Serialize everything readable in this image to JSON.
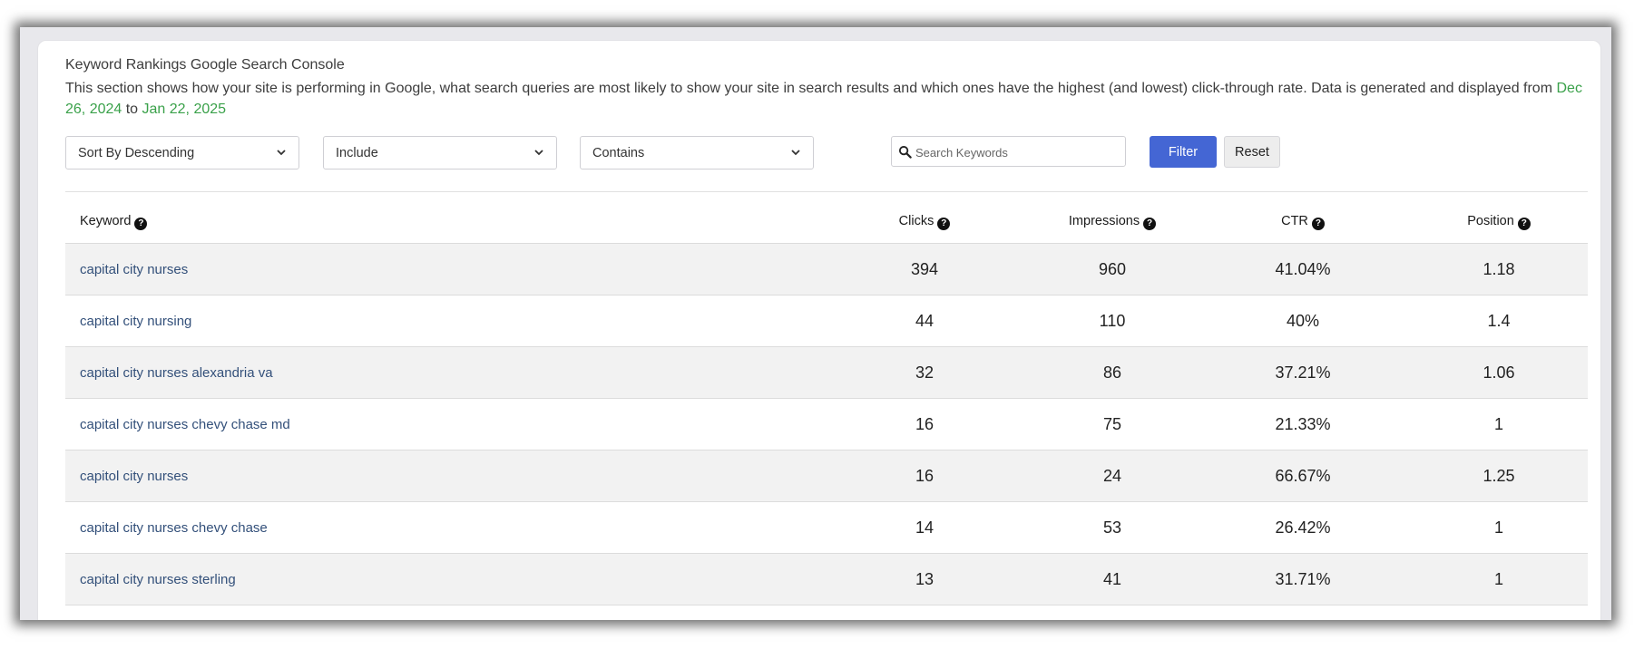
{
  "section": {
    "title": "Keyword Rankings Google Search Console",
    "description": "This section shows how your site is performing in Google, what search queries are most likely to show your site in search results and which ones have the highest (and lowest) click-through rate. Data is generated and displayed from ",
    "date_from": "Dec 26, 2024",
    "date_joiner": " to ",
    "date_to": "Jan 22, 2025",
    "accent_color": "#3aa14a"
  },
  "filters": {
    "sort_value": "Sort By Descending",
    "include_value": "Include",
    "match_value": "Contains",
    "search_placeholder": "Search Keywords",
    "filter_label": "Filter",
    "reset_label": "Reset",
    "filter_color": "#4466d4"
  },
  "table": {
    "headers": {
      "keyword": "Keyword",
      "clicks": "Clicks",
      "impressions": "Impressions",
      "ctr": "CTR",
      "position": "Position"
    },
    "rows": [
      {
        "keyword": "capital city nurses",
        "clicks": "394",
        "impressions": "960",
        "ctr": "41.04%",
        "position": "1.18"
      },
      {
        "keyword": "capital city nursing",
        "clicks": "44",
        "impressions": "110",
        "ctr": "40%",
        "position": "1.4"
      },
      {
        "keyword": "capital city nurses alexandria va",
        "clicks": "32",
        "impressions": "86",
        "ctr": "37.21%",
        "position": "1.06"
      },
      {
        "keyword": "capital city nurses chevy chase md",
        "clicks": "16",
        "impressions": "75",
        "ctr": "21.33%",
        "position": "1"
      },
      {
        "keyword": "capitol city nurses",
        "clicks": "16",
        "impressions": "24",
        "ctr": "66.67%",
        "position": "1.25"
      },
      {
        "keyword": "capital city nurses chevy chase",
        "clicks": "14",
        "impressions": "53",
        "ctr": "26.42%",
        "position": "1"
      },
      {
        "keyword": "capital city nurses sterling",
        "clicks": "13",
        "impressions": "41",
        "ctr": "31.71%",
        "position": "1"
      }
    ]
  }
}
